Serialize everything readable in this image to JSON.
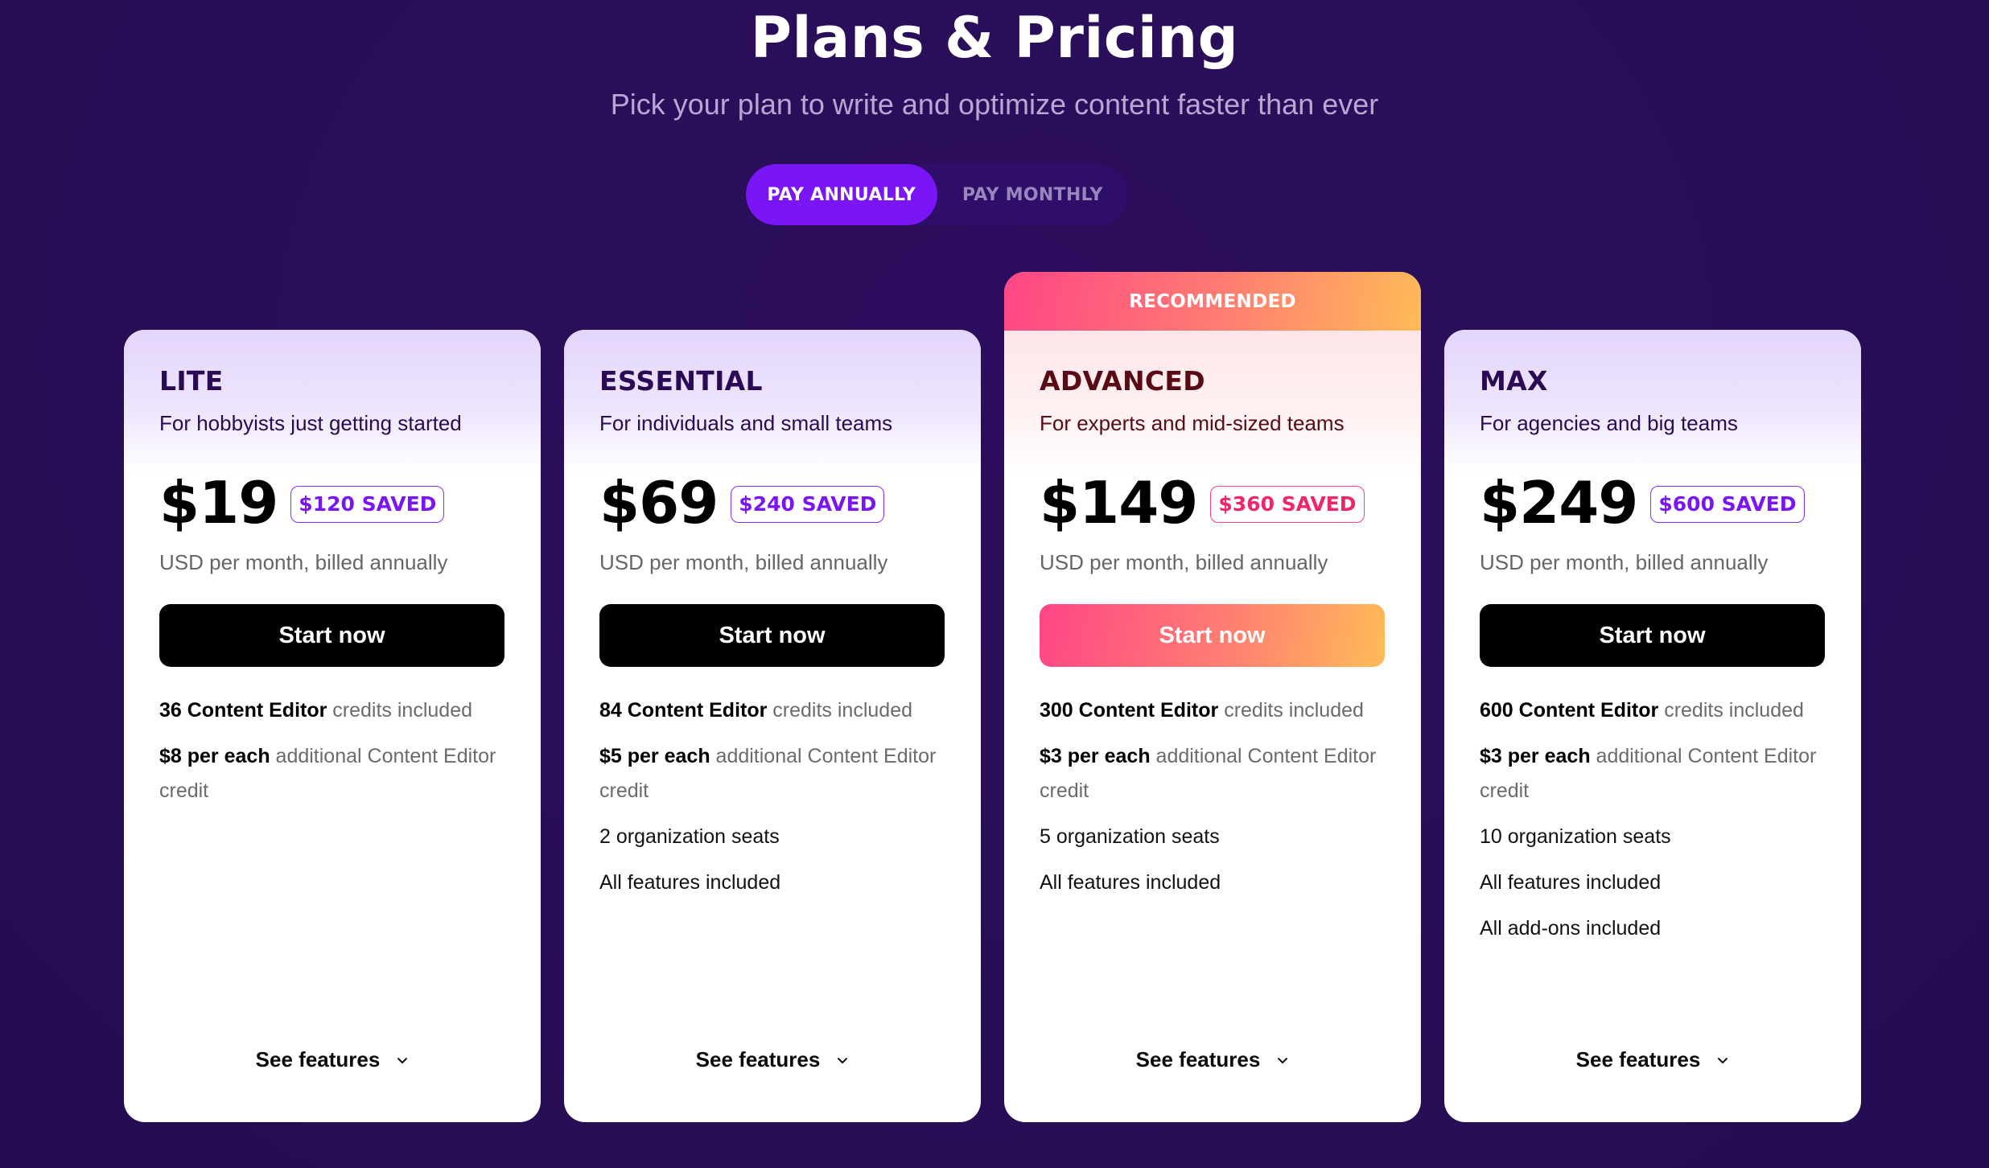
{
  "header": {
    "title": "Plans & Pricing",
    "subtitle": "Pick your plan to write and optimize content faster than ever"
  },
  "billing_toggle": {
    "options": [
      {
        "label": "PAY ANNUALLY",
        "active": true
      },
      {
        "label": "PAY MONTHLY",
        "active": false
      }
    ]
  },
  "colors": {
    "background": "#290e58",
    "accent": "#7a16f5",
    "recommended_gradient_start": "#ff4686",
    "recommended_gradient_end": "#ffbb58"
  },
  "plans": [
    {
      "name": "LITE",
      "tagline": "For hobbyists just getting started",
      "price": "$19",
      "saved": "$120 SAVED",
      "billing_note": "USD per month, billed annually",
      "cta": "Start now",
      "recommended": false,
      "features": [
        {
          "bold": "36 Content Editor",
          "muted": " credits included",
          "plain": ""
        },
        {
          "bold": "$8 per each",
          "muted": " additional Content Editor credit",
          "plain": ""
        }
      ],
      "see_features": "See features"
    },
    {
      "name": "ESSENTIAL",
      "tagline": "For individuals and small teams",
      "price": "$69",
      "saved": "$240 SAVED",
      "billing_note": "USD per month, billed annually",
      "cta": "Start now",
      "recommended": false,
      "features": [
        {
          "bold": "84 Content Editor",
          "muted": " credits included",
          "plain": ""
        },
        {
          "bold": "$5 per each",
          "muted": " additional Content Editor credit",
          "plain": ""
        },
        {
          "bold": "",
          "muted": "",
          "plain": "2 organization seats"
        },
        {
          "bold": "",
          "muted": "",
          "plain": "All features included"
        }
      ],
      "see_features": "See features"
    },
    {
      "name": "ADVANCED",
      "tagline": "For experts and mid-sized teams",
      "price": "$149",
      "saved": "$360 SAVED",
      "billing_note": "USD per month, billed annually",
      "cta": "Start now",
      "recommended": true,
      "recommended_label": "RECOMMENDED",
      "features": [
        {
          "bold": "300 Content Editor",
          "muted": " credits included",
          "plain": ""
        },
        {
          "bold": "$3 per each",
          "muted": " additional Content Editor credit",
          "plain": ""
        },
        {
          "bold": "",
          "muted": "",
          "plain": "5 organization seats"
        },
        {
          "bold": "",
          "muted": "",
          "plain": "All features included"
        }
      ],
      "see_features": "See features"
    },
    {
      "name": "MAX",
      "tagline": "For agencies and big teams",
      "price": "$249",
      "saved": "$600 SAVED",
      "billing_note": "USD per month, billed annually",
      "cta": "Start now",
      "recommended": false,
      "features": [
        {
          "bold": "600 Content Editor",
          "muted": " credits included",
          "plain": ""
        },
        {
          "bold": "$3 per each",
          "muted": " additional Content Editor credit",
          "plain": ""
        },
        {
          "bold": "",
          "muted": "",
          "plain": "10 organization seats"
        },
        {
          "bold": "",
          "muted": "",
          "plain": "All features included"
        },
        {
          "bold": "",
          "muted": "",
          "plain": "All add-ons included"
        }
      ],
      "see_features": "See features"
    }
  ]
}
